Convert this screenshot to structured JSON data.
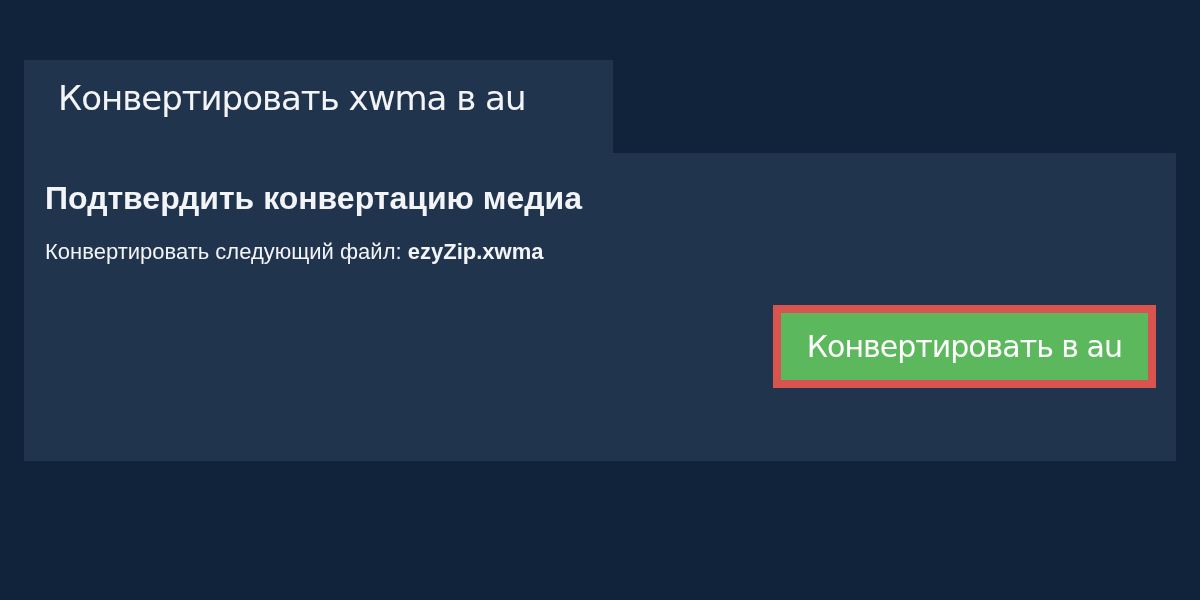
{
  "tab": {
    "label": "Конвертировать xwma в au"
  },
  "panel": {
    "heading": "Подтвердить конвертацию медиа",
    "message": "Конвертировать следующий файл: **ezyZip.xwma**"
  },
  "button": {
    "label": "Конвертировать в au",
    "highlighted": true
  }
}
